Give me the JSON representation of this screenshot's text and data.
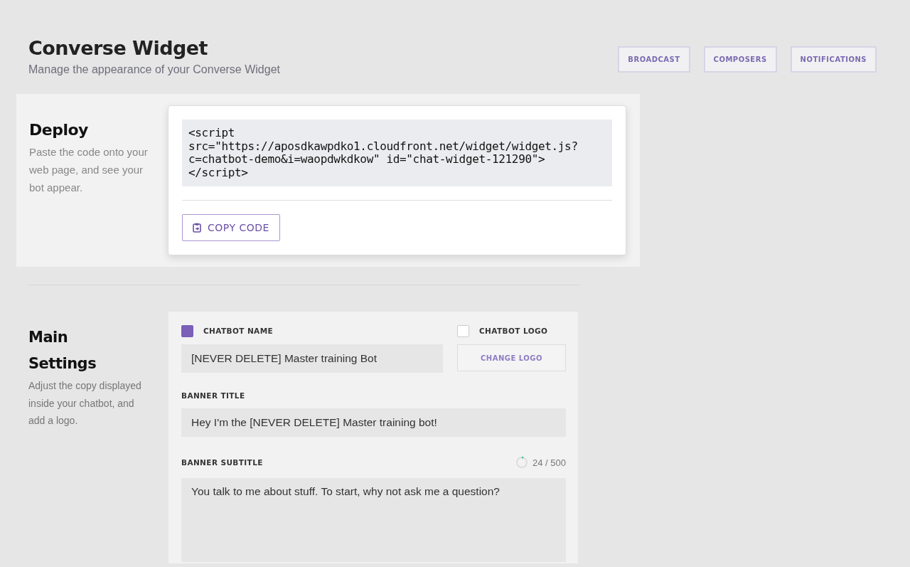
{
  "header": {
    "title": "Converse Widget",
    "subtitle": "Manage the appearance of your Converse Widget"
  },
  "nav_buttons": [
    {
      "label": "BROADCAST"
    },
    {
      "label": "COMPOSERS"
    },
    {
      "label": "NOTIFICATIONS"
    }
  ],
  "deploy": {
    "title": "Deploy",
    "description": "Paste the code onto your web page, and see your bot appear.",
    "code_lines": [
      "<script",
      "src=\"https://aposdkawpdko1.cloudfront.net/widget/widget.js?",
      "c=chatbot-demo&i=waopdwkdkow\" id=\"chat-widget-121290\">",
      "</script>"
    ],
    "copy_button": "COPY CODE"
  },
  "main_settings": {
    "title": "Main Settings",
    "description": "Adjust the copy displayed inside your chatbot, and add a logo.",
    "chatbot_name": {
      "label": "CHATBOT NAME",
      "checked": true,
      "value": "[NEVER DELETE] Master training Bot"
    },
    "chatbot_logo": {
      "label": "CHATBOT LOGO",
      "checked": false,
      "button": "CHANGE LOGO"
    },
    "banner_title": {
      "label": "BANNER TITLE",
      "value": "Hey I'm the [NEVER DELETE] Master training bot!"
    },
    "banner_subtitle": {
      "label": "BANNER SUBTITLE",
      "counter": "24 / 500",
      "level": 0.048,
      "value": "You talk to me about stuff. To start, why not ask me a question?"
    }
  }
}
